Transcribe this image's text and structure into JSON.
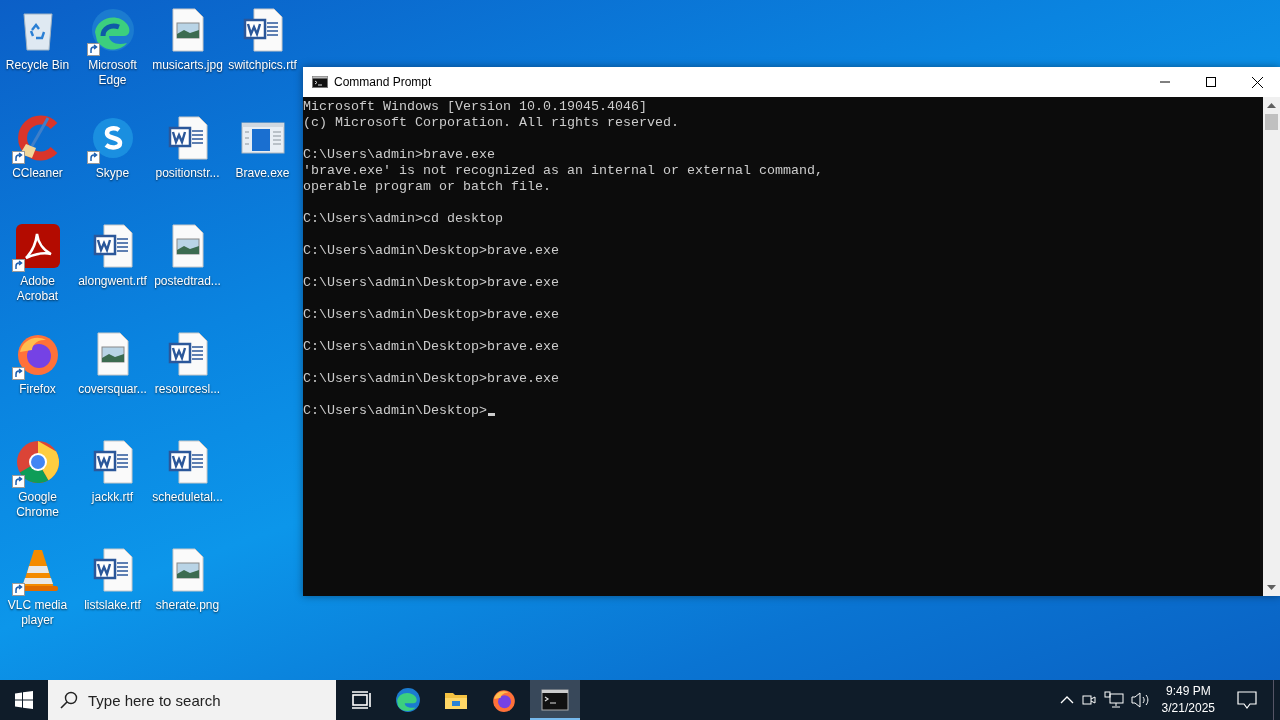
{
  "desktop_icons": [
    {
      "label": "Recycle Bin",
      "kind": "recycle",
      "shortcut": false
    },
    {
      "label": "CCleaner",
      "kind": "ccleaner",
      "shortcut": true
    },
    {
      "label": "Adobe Acrobat",
      "kind": "acrobat",
      "shortcut": true
    },
    {
      "label": "Firefox",
      "kind": "firefox",
      "shortcut": true
    },
    {
      "label": "Google Chrome",
      "kind": "chrome",
      "shortcut": true
    },
    {
      "label": "VLC media player",
      "kind": "vlc",
      "shortcut": true
    },
    {
      "label": "Microsoft Edge",
      "kind": "edge",
      "shortcut": true
    },
    {
      "label": "Skype",
      "kind": "skype",
      "shortcut": true
    },
    {
      "label": "alongwent.rtf",
      "kind": "word",
      "shortcut": false
    },
    {
      "label": "coversquar...",
      "kind": "image",
      "shortcut": false
    },
    {
      "label": "jackk.rtf",
      "kind": "word",
      "shortcut": false
    },
    {
      "label": "listslake.rtf",
      "kind": "word",
      "shortcut": false
    },
    {
      "label": "musicarts.jpg",
      "kind": "image",
      "shortcut": false
    },
    {
      "label": "positionstr...",
      "kind": "word",
      "shortcut": false
    },
    {
      "label": "postedtrad...",
      "kind": "image",
      "shortcut": false
    },
    {
      "label": "resourcesl...",
      "kind": "word",
      "shortcut": false
    },
    {
      "label": "scheduletal...",
      "kind": "word",
      "shortcut": false
    },
    {
      "label": "sherate.png",
      "kind": "image",
      "shortcut": false
    },
    {
      "label": "switchpics.rtf",
      "kind": "word",
      "shortcut": false
    },
    {
      "label": "Brave.exe",
      "kind": "exe",
      "shortcut": false
    }
  ],
  "window": {
    "title": "Command Prompt",
    "blocks": [
      [
        "Microsoft Windows [Version 10.0.19045.4046]",
        "(c) Microsoft Corporation. All rights reserved."
      ],
      [
        "C:\\Users\\admin>brave.exe",
        "'brave.exe' is not recognized as an internal or external command,",
        "operable program or batch file."
      ],
      [
        "C:\\Users\\admin>cd desktop"
      ],
      [
        "C:\\Users\\admin\\Desktop>brave.exe"
      ],
      [
        "C:\\Users\\admin\\Desktop>brave.exe"
      ],
      [
        "C:\\Users\\admin\\Desktop>brave.exe"
      ],
      [
        "C:\\Users\\admin\\Desktop>brave.exe"
      ],
      [
        "C:\\Users\\admin\\Desktop>brave.exe"
      ],
      [
        "C:\\Users\\admin\\Desktop>"
      ]
    ]
  },
  "taskbar": {
    "search": {
      "placeholder": "Type here to search"
    },
    "apps": [
      {
        "kind": "taskview",
        "selected": false
      },
      {
        "kind": "edge",
        "selected": false
      },
      {
        "kind": "explorer",
        "selected": false
      },
      {
        "kind": "firefox",
        "selected": false
      },
      {
        "kind": "cmd",
        "selected": true
      }
    ],
    "time": "9:49 PM",
    "date": "3/21/2025"
  }
}
